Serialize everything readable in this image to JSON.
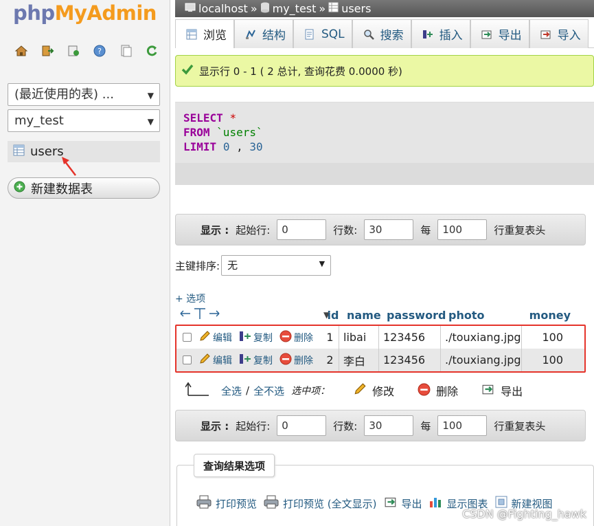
{
  "nav": {
    "logo_php": "php",
    "logo_ma": "MyAdmin",
    "icons": [
      "home-icon",
      "exit-icon",
      "query-icon",
      "help-icon",
      "docs-icon",
      "reload-icon"
    ],
    "recent_select": "(最近使用的表) ...",
    "db_select": "my_test",
    "table_item": "users",
    "new_table": "新建数据表"
  },
  "breadcrumb": {
    "server": "localhost",
    "sep": "»",
    "database": "my_test",
    "table": "users"
  },
  "tabs": [
    {
      "label": "浏览",
      "icon": "browse-icon"
    },
    {
      "label": "结构",
      "icon": "structure-icon"
    },
    {
      "label": "SQL",
      "icon": "sql-icon"
    },
    {
      "label": "搜索",
      "icon": "search-icon"
    },
    {
      "label": "插入",
      "icon": "insert-icon"
    },
    {
      "label": "导出",
      "icon": "export-icon"
    },
    {
      "label": "导入",
      "icon": "import-icon"
    }
  ],
  "success_msg": "显示行 0 - 1 ( 2 总计, 查询花费 0.0000 秒)",
  "sql": {
    "select": "SELECT",
    "star": "*",
    "from": "FROM",
    "table": "`users`",
    "limit": "LIMIT",
    "offset": "0",
    "comma": ",",
    "count": "30"
  },
  "pager": {
    "show_label": "显示 :",
    "start_label": "起始行:",
    "start_value": "0",
    "rows_label": "行数:",
    "rows_value": "30",
    "every_label": "每",
    "every_value": "100",
    "repeat_label": "行重复表头"
  },
  "sort": {
    "label": "主键排序:",
    "value": "无"
  },
  "options_link": "+ 选项",
  "table": {
    "columns": [
      "id",
      "name",
      "password",
      "photo",
      "money"
    ],
    "actions": {
      "edit": "编辑",
      "copy": "复制",
      "delete": "删除"
    },
    "rows": [
      {
        "id": "1",
        "name": "libai",
        "password": "123456",
        "photo": "./touxiang.jpg",
        "money": "100"
      },
      {
        "id": "2",
        "name": "李白",
        "password": "123456",
        "photo": "./touxiang.jpg",
        "money": "100"
      }
    ]
  },
  "bulk": {
    "check_all": "全选",
    "slash": "/",
    "uncheck_all": "全不选",
    "selected": "选中项：",
    "modify": "修改",
    "delete": "删除",
    "export": "导出"
  },
  "query_options": {
    "legend": "查询结果选项",
    "print": "打印预览",
    "print_full": "打印预览 (全文显示)",
    "export": "导出",
    "chart": "显示图表",
    "create_view": "新建视图"
  },
  "watermark": "CSDN @Fighting_hawk",
  "colors": {
    "link": "#235a81",
    "success_bg": "#ebf8a4",
    "highlight_border": "#e5332a",
    "logo_php": "#6c78af",
    "logo_ma": "#f49b1e"
  }
}
